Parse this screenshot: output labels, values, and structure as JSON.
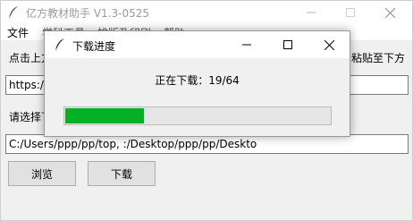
{
  "app": {
    "title": "亿方教材助手 V1.3-0525",
    "icon": "feather-icon"
  },
  "menu": {
    "items": [
      "文件",
      "学科工具",
      "排版及印刷",
      "帮助"
    ]
  },
  "main": {
    "hint_left": "点击上方",
    "hint_right": "粘贴至下方",
    "url_value": "https://",
    "select_label": "请选择下",
    "path_value": "C:/Users/ppp/pp/top,  :/Desktop/ppp/pp/Deskto",
    "browse_label": "浏览",
    "download_label": "下载"
  },
  "dialog": {
    "title": "下载进度",
    "status_prefix": "正在下载：",
    "status_count": "19/64",
    "progress_fraction": 0.2969
  },
  "colors": {
    "progress": "#06b025",
    "title_inactive": "#9a9a9a"
  }
}
